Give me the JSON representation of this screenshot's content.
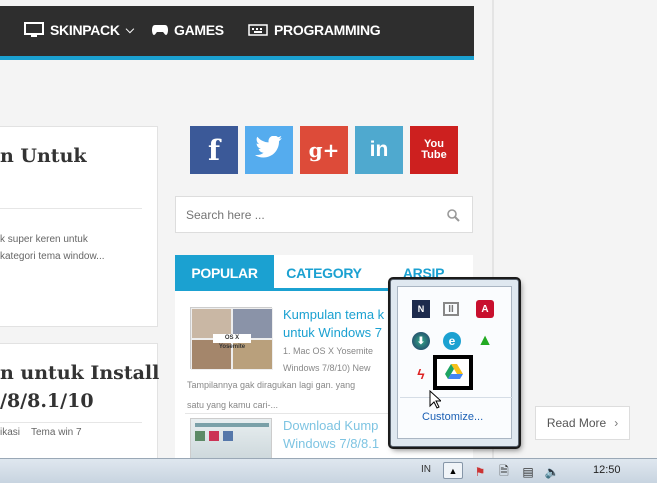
{
  "nav": {
    "items": [
      {
        "label": "SKINPACK",
        "icon": "monitor-icon"
      },
      {
        "label": "GAMES",
        "icon": "gamepad-icon"
      },
      {
        "label": "PROGRAMMING",
        "icon": "keyboard-icon"
      }
    ]
  },
  "posts": [
    {
      "title": "n Untuk",
      "excerpt_1": "k super keren untuk",
      "excerpt_2": "kategori tema window..."
    },
    {
      "title_1": "n untuk Install",
      "title_2": "/8/8.1/10",
      "tags": [
        "ikasi",
        "Tema win 7"
      ]
    }
  ],
  "social": [
    {
      "name": "facebook",
      "glyph": "f",
      "color": "#3b5998"
    },
    {
      "name": "twitter",
      "glyph": "🐦",
      "color": "#55acee"
    },
    {
      "name": "google-plus",
      "glyph": "g+",
      "color": "#dd4b39"
    },
    {
      "name": "linkedin",
      "glyph": "in",
      "color": "#4fa9cf"
    },
    {
      "name": "youtube",
      "glyph": "You Tube",
      "color": "#cd201f"
    }
  ],
  "search": {
    "placeholder": "Search here ..."
  },
  "tabs": [
    "POPULAR",
    "CATEGORY",
    "ARSIP"
  ],
  "popular": [
    {
      "title_1": "Kumpulan tema k",
      "title_2": "untuk Windows 7",
      "meta": "1.   Mac OS X Yosemite",
      "meta_2": "Windows 7/8/10)   New",
      "desc_1": "Tampilannya gak diragukan lagi gan. yang",
      "desc_2": "satu yang kamu cari-..."
    },
    {
      "title_1": "Download Kump",
      "title_2": "Windows 7/8/8.1"
    }
  ],
  "thumb_caption": "OS X Yosemite",
  "read_more": "Read More",
  "tray_popup": {
    "customize": "Customize..."
  },
  "taskbar": {
    "lang": "IN",
    "time": "12:50"
  },
  "colors": {
    "accent": "#1ba1d1",
    "nav": "#2e2e2e"
  }
}
